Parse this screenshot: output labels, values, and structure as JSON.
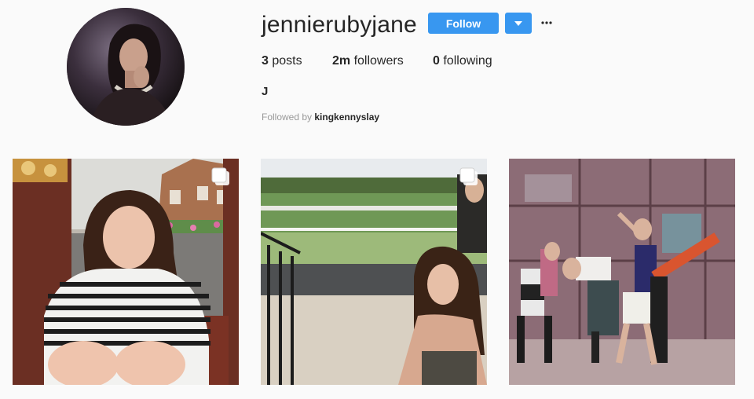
{
  "profile": {
    "username": "jennierubyjane",
    "full_name": "J",
    "follow_label": "Follow",
    "followed_by_prefix": "Followed by",
    "followed_by_user": "kingkennyslay"
  },
  "stats": {
    "posts_count": "3",
    "posts_label": "posts",
    "followers_count": "2m",
    "followers_label": "followers",
    "following_count": "0",
    "following_label": "following"
  },
  "icons": {
    "dropdown": "chevron-down-icon",
    "more": "ellipsis-icon",
    "multi_post": "carousel-icon"
  },
  "colors": {
    "accent": "#3897f0",
    "background": "#fafafa",
    "text": "#262626",
    "muted": "#999999"
  },
  "posts": [
    {
      "type": "carousel"
    },
    {
      "type": "carousel"
    },
    {
      "type": "single"
    }
  ]
}
